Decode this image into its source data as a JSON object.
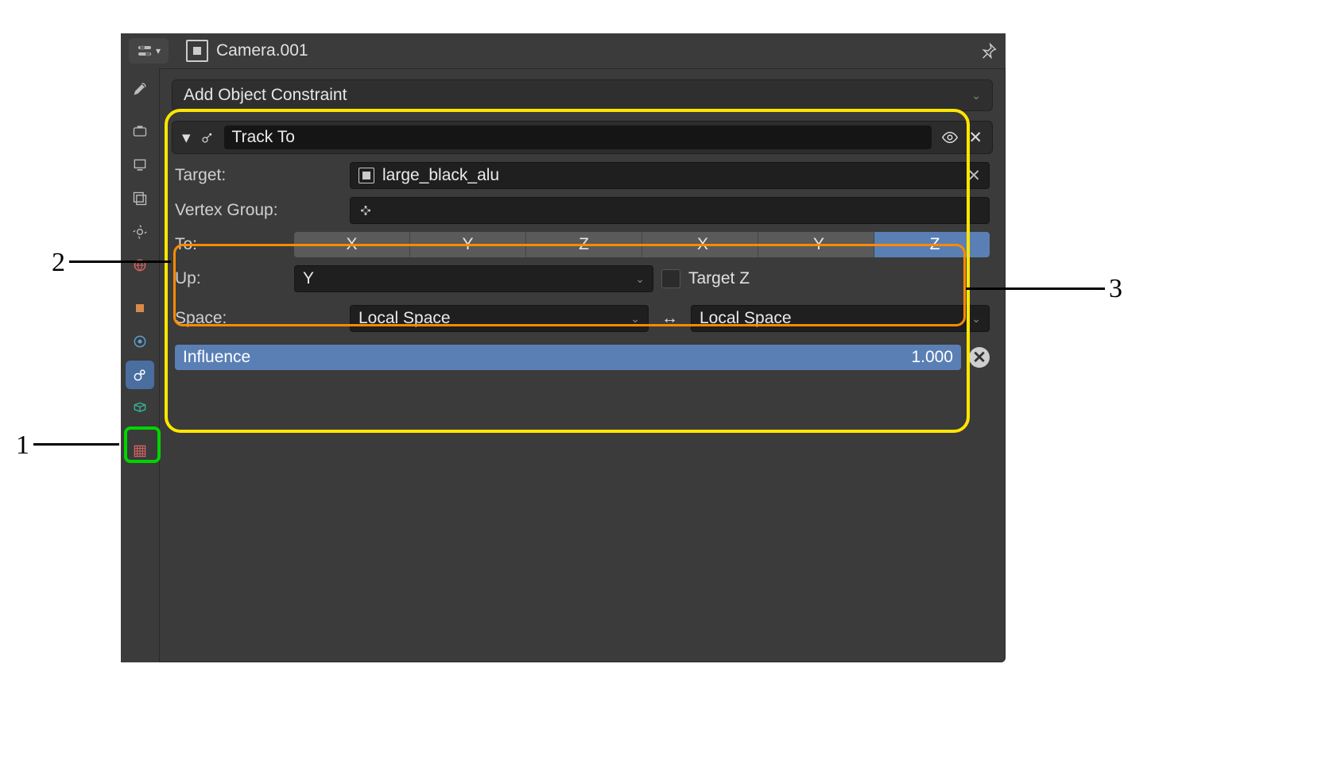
{
  "header": {
    "object_name": "Camera.001"
  },
  "add_constraint_label": "Add Object Constraint",
  "constraint": {
    "name": "Track To",
    "target_label": "Target:",
    "target_value": "large_black_alu",
    "vertex_group_label": "Vertex Group:",
    "to_label": "To:",
    "to_options": [
      "X",
      "Y",
      "Z",
      "-X",
      "-Y",
      "-Z"
    ],
    "to_selected": "-Z",
    "up_label": "Up:",
    "up_value": "Y",
    "target_z_label": "Target Z",
    "target_z_checked": false,
    "space_label": "Space:",
    "space_left": "Local Space",
    "space_right": "Local Space",
    "influence_label": "Influence",
    "influence_value": "1.000"
  },
  "annotations": {
    "n1": "1",
    "n2": "2",
    "n3": "3"
  }
}
